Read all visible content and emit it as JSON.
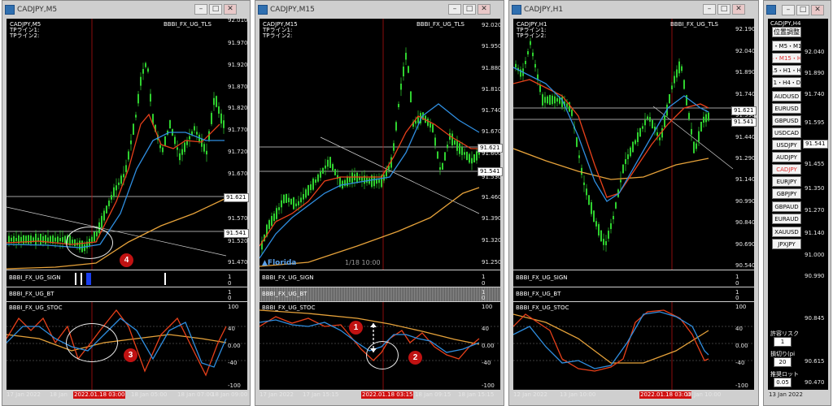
{
  "windows": [
    {
      "title": "CADJPY,M5",
      "indicator": "BBBI_FX_UG_TLS",
      "tp1": "TPライン1:",
      "tp2": "TPライン2:",
      "y_ticks": [
        "92.010",
        "91.970",
        "91.920",
        "91.870",
        "91.820",
        "91.770",
        "91.720",
        "91.670",
        "91.621",
        "91.570",
        "91.541",
        "91.520",
        "91.470"
      ],
      "price_tags": [
        "91.621",
        "91.541"
      ],
      "sub1": "BBBI_FX_UG_SIGN",
      "sub2": "BBBI_FX_UG_BT",
      "sub3": "BBBI_FX_UG_STOC",
      "sub_ticks": [
        "1",
        "0",
        "1",
        "0"
      ],
      "stoc_ticks": [
        "100",
        "40",
        "0.00",
        "-40",
        "-100"
      ],
      "x_ticks": [
        "17 Jan 2022",
        "18 Jan",
        "18 Jan 05:00",
        "18 Jan 07:00",
        "18 Jan 09:00"
      ],
      "x_highlight": "2022.01.18 03:00",
      "badges": [
        "4",
        "3"
      ]
    },
    {
      "title": "CADJPY,M15",
      "indicator": "BBBI_FX_UG_TLS",
      "tp1": "TPライン1:",
      "tp2": "TPライン2:",
      "y_ticks": [
        "92.020",
        "91.950",
        "91.880",
        "91.810",
        "91.740",
        "91.670",
        "91.621",
        "91.600",
        "91.541",
        "91.530",
        "91.460",
        "91.390",
        "91.320",
        "91.250"
      ],
      "price_tags": [
        "91.621",
        "91.541"
      ],
      "logo": "Florida",
      "date_label": "1/18 10:00",
      "sub1": "BBBI_FX_UG_SIGN",
      "sub2": "BBBI_FX_UG_BT",
      "sub3": "BBBI_FX_UG_STOC",
      "sub_ticks": [
        "1",
        "0",
        "1",
        "0"
      ],
      "stoc_ticks": [
        "100",
        "40",
        "0.00",
        "-40",
        "-100"
      ],
      "x_ticks": [
        "17 Jan 2022",
        "17 Jan 15:15",
        "18 Jan 09:15",
        "18 Jan 15:15"
      ],
      "x_highlight": "2022.01.18 03:15",
      "badges": [
        "1",
        "2"
      ]
    },
    {
      "title": "CADJPY,H1",
      "indicator": "BBBI_FX_UG_TLS",
      "tp1": "TPライン1:",
      "tp2": "TPライン2:",
      "y_ticks": [
        "92.190",
        "92.040",
        "91.890",
        "91.740",
        "91.621",
        "91.590",
        "91.541",
        "91.440",
        "91.290",
        "91.140",
        "90.990",
        "90.840",
        "90.690",
        "90.540"
      ],
      "price_tags": [
        "91.621",
        "91.541"
      ],
      "sub1": "BBBI_FX_UG_SIGN",
      "sub2": "BBBI_FX_UG_BT",
      "sub3": "BBBI_FX_UG_STOC",
      "sub_ticks": [
        "1",
        "0",
        "1",
        "0"
      ],
      "stoc_ticks": [
        "100",
        "40",
        "0.00",
        "-40",
        "-100"
      ],
      "x_ticks": [
        "12 Jan 2022",
        "13 Jan 10:00",
        "18 Jan 10:00"
      ],
      "x_highlight": "2022.01.18 03:00"
    }
  ],
  "panel": {
    "title": "CADJPY,H4",
    "buttons": [
      "位置調整",
      "I1・M5・M15",
      "I5・M15・H1",
      "I15・H1・H4",
      "H1・H4・D1",
      "AUDUSD",
      "EURUSD",
      "GBPUSD",
      "USDCAD",
      "USDJPY",
      "AUDJPY",
      "CADJPY",
      "EURJPY",
      "GBPJPY",
      "GBPAUD",
      "EURAUD",
      "XAUUSD",
      "JPXJPY"
    ],
    "y_ticks": [
      "92.040",
      "91.890",
      "91.740",
      "91.595",
      "91.455",
      "91.350",
      "91.270",
      "91.140",
      "91.000",
      "90.990",
      "90.845",
      "90.615",
      "90.470"
    ],
    "price_tag": "91.541",
    "risk_label": "許容リスク",
    "risk_value": "1",
    "cut_label": "損切り(pi",
    "cut_value": "20",
    "lot_label": "推奨ロット",
    "lot_value": "0.05",
    "x_label": "13 Jan 2022"
  },
  "colors": {
    "bg": "#000000",
    "candle": "#2fd12f",
    "ma_red": "#e8401a",
    "ma_blue": "#2f8ee0",
    "ma_orange": "#e6a23a",
    "badge": "#c01212"
  }
}
